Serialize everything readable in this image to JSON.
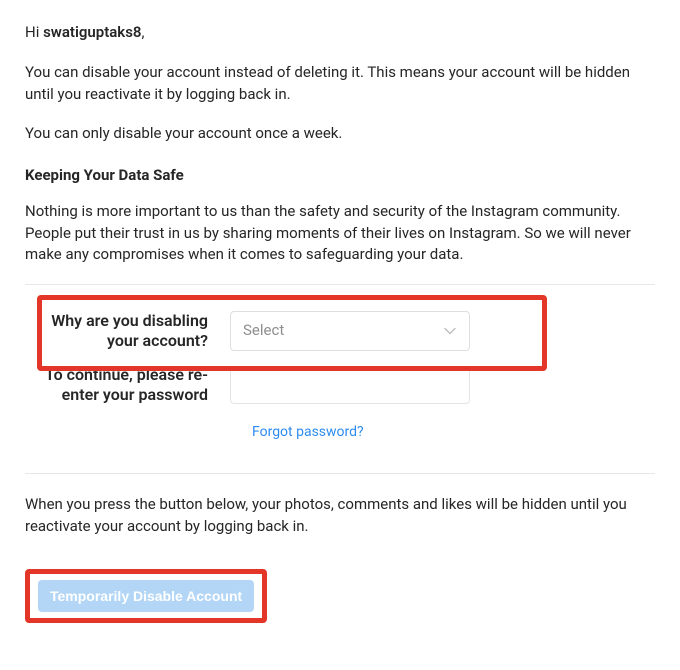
{
  "greeting": {
    "prefix": "Hi ",
    "username": "swatiguptaks8",
    "suffix": ","
  },
  "intro1": "You can disable your account instead of deleting it. This means your account will be hidden until you reactivate it by logging back in.",
  "intro2": "You can only disable your account once a week.",
  "safe": {
    "title": "Keeping Your Data Safe",
    "body": "Nothing is more important to us than the safety and security of the Instagram community. People put their trust in us by sharing moments of their lives on Instagram. So we will never make any compromises when it comes to safeguarding your data."
  },
  "form": {
    "reason_label": "Why are you disabling your account?",
    "reason_placeholder": "Select",
    "password_label": "To continue, please re-enter your password",
    "password_value": "",
    "forgot_link": "Forgot password?"
  },
  "confirm_text": "When you press the button below, your photos, comments and likes will be hidden until you reactivate your account by logging back in.",
  "disable_button": "Temporarily Disable Account"
}
